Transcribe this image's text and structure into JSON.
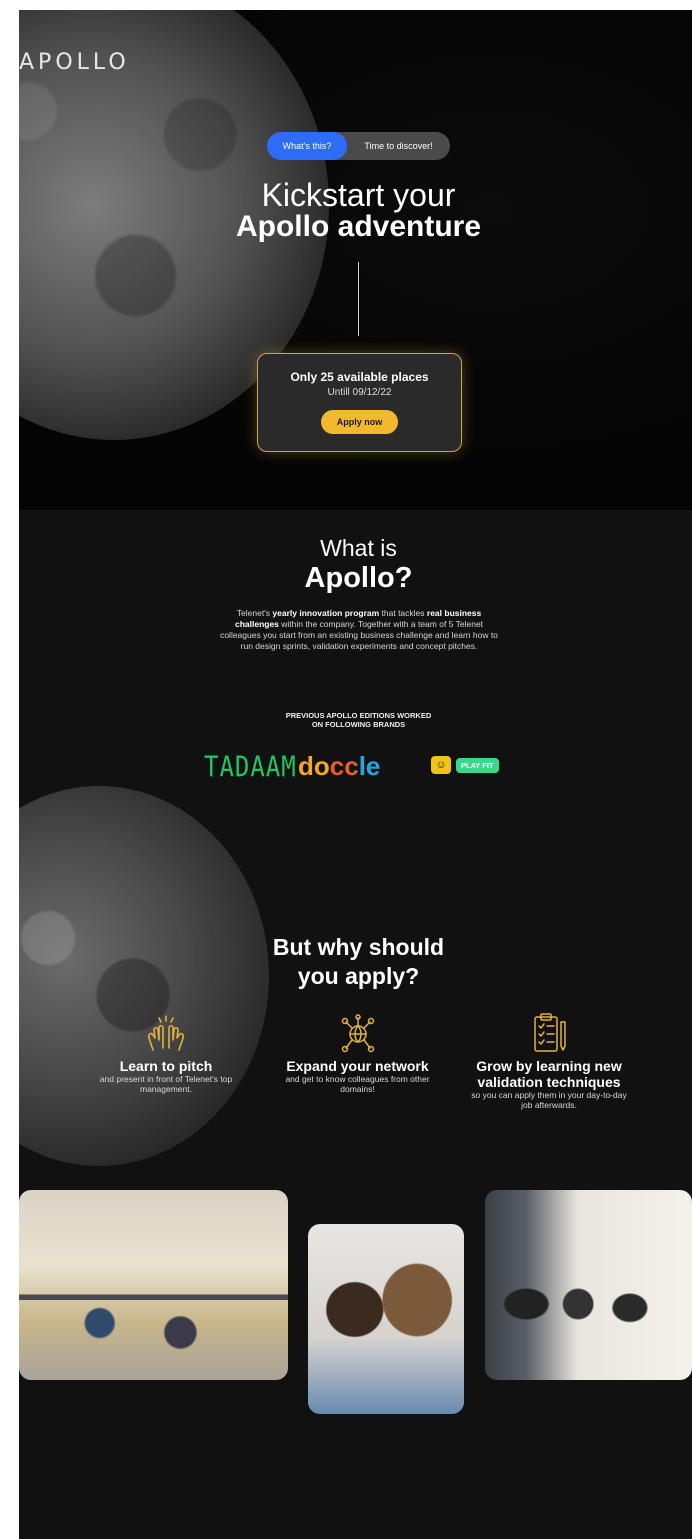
{
  "brand": {
    "logo": "APOLLO"
  },
  "hero": {
    "pill_active": "What's this?",
    "pill_text": "Time to discover!",
    "title_line1": "Kickstart your",
    "title_line2": "Apollo adventure"
  },
  "cta": {
    "title": "Only 25 available places",
    "subtitle": "Untill 09/12/22",
    "button": "Apply now"
  },
  "about": {
    "title_line1": "What is",
    "title_line2": "Apollo?",
    "desc_p1": "Telenet's ",
    "desc_b1": "yearly innovation program",
    "desc_p2": " that tackles ",
    "desc_b2": "real business challenges",
    "desc_p3": " within the company. Together with a team of 5 Telenet colleagues you start from an existing business challenge and learn how to run design sprints, validation experiments and concept pitches."
  },
  "brands": {
    "heading_line1": "PREVIOUS APOLLO EDITIONS WORKED",
    "heading_line2": "ON FOLLOWING  BRANDS",
    "tadaam": "TADAAM",
    "doccle_a": "do",
    "doccle_b": "cc",
    "doccle_c": "le",
    "playfit": "PLAY FIT"
  },
  "why": {
    "title_line1": "But why should",
    "title_line2": "you apply?",
    "features": [
      {
        "title": "Learn to pitch",
        "desc": "and present in front of Telenet's top management."
      },
      {
        "title": "Expand your network",
        "desc": "and get to know colleagues from other domains!"
      },
      {
        "title": "Grow by learning new validation techniques",
        "desc": "so you can apply them in your day-to-day job afterwards."
      }
    ]
  },
  "colors": {
    "accent_blue": "#2d6cf6",
    "accent_gold": "#f3b92e",
    "background": "#111111"
  },
  "icons": [
    "clapping-hands-icon",
    "network-globe-icon",
    "clipboard-checklist-icon"
  ]
}
